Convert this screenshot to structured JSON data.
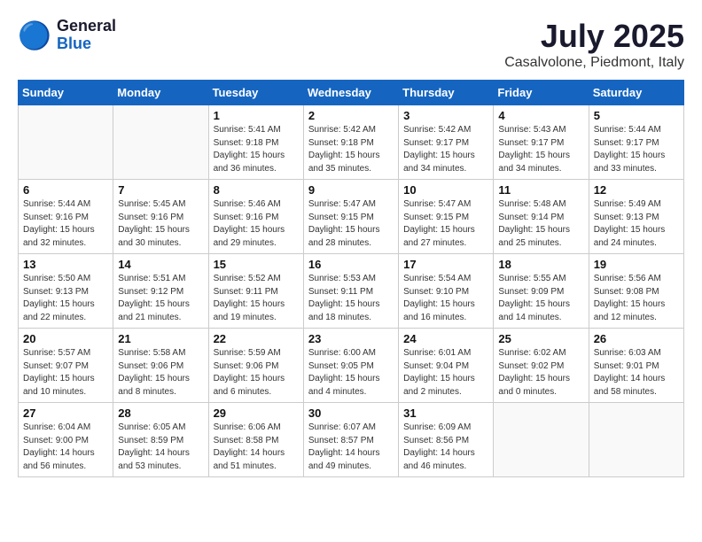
{
  "header": {
    "logo_general": "General",
    "logo_blue": "Blue",
    "month": "July 2025",
    "location": "Casalvolone, Piedmont, Italy"
  },
  "weekdays": [
    "Sunday",
    "Monday",
    "Tuesday",
    "Wednesday",
    "Thursday",
    "Friday",
    "Saturday"
  ],
  "weeks": [
    [
      {
        "day": "",
        "info": ""
      },
      {
        "day": "",
        "info": ""
      },
      {
        "day": "1",
        "info": "Sunrise: 5:41 AM\nSunset: 9:18 PM\nDaylight: 15 hours\nand 36 minutes."
      },
      {
        "day": "2",
        "info": "Sunrise: 5:42 AM\nSunset: 9:18 PM\nDaylight: 15 hours\nand 35 minutes."
      },
      {
        "day": "3",
        "info": "Sunrise: 5:42 AM\nSunset: 9:17 PM\nDaylight: 15 hours\nand 34 minutes."
      },
      {
        "day": "4",
        "info": "Sunrise: 5:43 AM\nSunset: 9:17 PM\nDaylight: 15 hours\nand 34 minutes."
      },
      {
        "day": "5",
        "info": "Sunrise: 5:44 AM\nSunset: 9:17 PM\nDaylight: 15 hours\nand 33 minutes."
      }
    ],
    [
      {
        "day": "6",
        "info": "Sunrise: 5:44 AM\nSunset: 9:16 PM\nDaylight: 15 hours\nand 32 minutes."
      },
      {
        "day": "7",
        "info": "Sunrise: 5:45 AM\nSunset: 9:16 PM\nDaylight: 15 hours\nand 30 minutes."
      },
      {
        "day": "8",
        "info": "Sunrise: 5:46 AM\nSunset: 9:16 PM\nDaylight: 15 hours\nand 29 minutes."
      },
      {
        "day": "9",
        "info": "Sunrise: 5:47 AM\nSunset: 9:15 PM\nDaylight: 15 hours\nand 28 minutes."
      },
      {
        "day": "10",
        "info": "Sunrise: 5:47 AM\nSunset: 9:15 PM\nDaylight: 15 hours\nand 27 minutes."
      },
      {
        "day": "11",
        "info": "Sunrise: 5:48 AM\nSunset: 9:14 PM\nDaylight: 15 hours\nand 25 minutes."
      },
      {
        "day": "12",
        "info": "Sunrise: 5:49 AM\nSunset: 9:13 PM\nDaylight: 15 hours\nand 24 minutes."
      }
    ],
    [
      {
        "day": "13",
        "info": "Sunrise: 5:50 AM\nSunset: 9:13 PM\nDaylight: 15 hours\nand 22 minutes."
      },
      {
        "day": "14",
        "info": "Sunrise: 5:51 AM\nSunset: 9:12 PM\nDaylight: 15 hours\nand 21 minutes."
      },
      {
        "day": "15",
        "info": "Sunrise: 5:52 AM\nSunset: 9:11 PM\nDaylight: 15 hours\nand 19 minutes."
      },
      {
        "day": "16",
        "info": "Sunrise: 5:53 AM\nSunset: 9:11 PM\nDaylight: 15 hours\nand 18 minutes."
      },
      {
        "day": "17",
        "info": "Sunrise: 5:54 AM\nSunset: 9:10 PM\nDaylight: 15 hours\nand 16 minutes."
      },
      {
        "day": "18",
        "info": "Sunrise: 5:55 AM\nSunset: 9:09 PM\nDaylight: 15 hours\nand 14 minutes."
      },
      {
        "day": "19",
        "info": "Sunrise: 5:56 AM\nSunset: 9:08 PM\nDaylight: 15 hours\nand 12 minutes."
      }
    ],
    [
      {
        "day": "20",
        "info": "Sunrise: 5:57 AM\nSunset: 9:07 PM\nDaylight: 15 hours\nand 10 minutes."
      },
      {
        "day": "21",
        "info": "Sunrise: 5:58 AM\nSunset: 9:06 PM\nDaylight: 15 hours\nand 8 minutes."
      },
      {
        "day": "22",
        "info": "Sunrise: 5:59 AM\nSunset: 9:06 PM\nDaylight: 15 hours\nand 6 minutes."
      },
      {
        "day": "23",
        "info": "Sunrise: 6:00 AM\nSunset: 9:05 PM\nDaylight: 15 hours\nand 4 minutes."
      },
      {
        "day": "24",
        "info": "Sunrise: 6:01 AM\nSunset: 9:04 PM\nDaylight: 15 hours\nand 2 minutes."
      },
      {
        "day": "25",
        "info": "Sunrise: 6:02 AM\nSunset: 9:02 PM\nDaylight: 15 hours\nand 0 minutes."
      },
      {
        "day": "26",
        "info": "Sunrise: 6:03 AM\nSunset: 9:01 PM\nDaylight: 14 hours\nand 58 minutes."
      }
    ],
    [
      {
        "day": "27",
        "info": "Sunrise: 6:04 AM\nSunset: 9:00 PM\nDaylight: 14 hours\nand 56 minutes."
      },
      {
        "day": "28",
        "info": "Sunrise: 6:05 AM\nSunset: 8:59 PM\nDaylight: 14 hours\nand 53 minutes."
      },
      {
        "day": "29",
        "info": "Sunrise: 6:06 AM\nSunset: 8:58 PM\nDaylight: 14 hours\nand 51 minutes."
      },
      {
        "day": "30",
        "info": "Sunrise: 6:07 AM\nSunset: 8:57 PM\nDaylight: 14 hours\nand 49 minutes."
      },
      {
        "day": "31",
        "info": "Sunrise: 6:09 AM\nSunset: 8:56 PM\nDaylight: 14 hours\nand 46 minutes."
      },
      {
        "day": "",
        "info": ""
      },
      {
        "day": "",
        "info": ""
      }
    ]
  ]
}
